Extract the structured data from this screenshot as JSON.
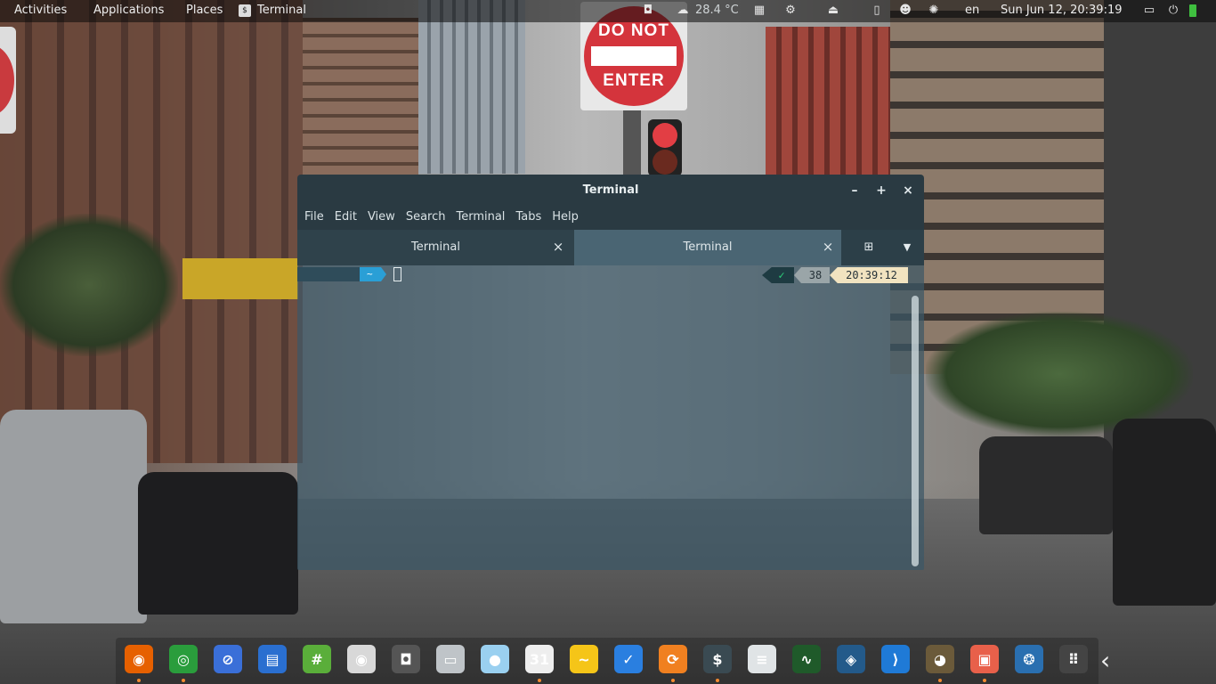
{
  "topbar": {
    "activities": "Activities",
    "applications": "Applications",
    "places": "Places",
    "focused_app": "Terminal",
    "weather": "28.4 °C",
    "language": "en",
    "clock": "Sun Jun 12, 20:39:19"
  },
  "wallpaper": {
    "sign_line1": "DO NOT",
    "sign_line2": "ENTER"
  },
  "window": {
    "title": "Terminal",
    "minimize": "–",
    "maximize": "+",
    "close": "×",
    "menus": [
      "File",
      "Edit",
      "View",
      "Search",
      "Terminal",
      "Tabs",
      "Help"
    ],
    "tabs": [
      {
        "label": "Terminal",
        "close": "×"
      },
      {
        "label": "Terminal",
        "close": "×"
      }
    ],
    "prompt": {
      "dir": "~",
      "status": "✓",
      "history_num": "38",
      "time": "20:39:12"
    }
  },
  "dock": {
    "items": [
      {
        "name": "firefox-icon",
        "color": "#e66000",
        "glyph": "◉"
      },
      {
        "name": "chrome-icon",
        "color": "#2a9d3c",
        "glyph": "◎"
      },
      {
        "name": "web-browser-icon",
        "color": "#3a6fd8",
        "glyph": "⊘"
      },
      {
        "name": "chat-icon",
        "color": "#2a6fd0",
        "glyph": "▤"
      },
      {
        "name": "hexchat-icon",
        "color": "#5aae3a",
        "glyph": "#"
      },
      {
        "name": "music-player-icon",
        "color": "#d8d8d8",
        "glyph": "◉"
      },
      {
        "name": "camera-icon",
        "color": "#555555",
        "glyph": "◘"
      },
      {
        "name": "files-icon",
        "color": "#bfc4c8",
        "glyph": "▭"
      },
      {
        "name": "bird-icon",
        "color": "#9ad0f0",
        "glyph": "●"
      },
      {
        "name": "calendar-icon",
        "color": "#eeeeee",
        "glyph": "31"
      },
      {
        "name": "notes-icon",
        "color": "#f5c518",
        "glyph": "~"
      },
      {
        "name": "tasks-icon",
        "color": "#2a7fe0",
        "glyph": "✓"
      },
      {
        "name": "software-update-icon",
        "color": "#f08020",
        "glyph": "⟳"
      },
      {
        "name": "terminal-icon",
        "color": "#3a4a52",
        "glyph": "$"
      },
      {
        "name": "settings-icon",
        "color": "#e0e4e6",
        "glyph": "≡"
      },
      {
        "name": "system-monitor-icon",
        "color": "#1f5a2a",
        "glyph": "∿"
      },
      {
        "name": "database-icon",
        "color": "#235a8a",
        "glyph": "◈"
      },
      {
        "name": "vscode-icon",
        "color": "#1f7ad6",
        "glyph": "⟩"
      },
      {
        "name": "gimp-icon",
        "color": "#6b5a3a",
        "glyph": "◕"
      },
      {
        "name": "screenshot-icon",
        "color": "#e8604a",
        "glyph": "▣"
      },
      {
        "name": "steam-icon",
        "color": "#2a6fb0",
        "glyph": "❂"
      },
      {
        "name": "app-grid-icon",
        "color": "#444444",
        "glyph": "⠿"
      }
    ]
  }
}
